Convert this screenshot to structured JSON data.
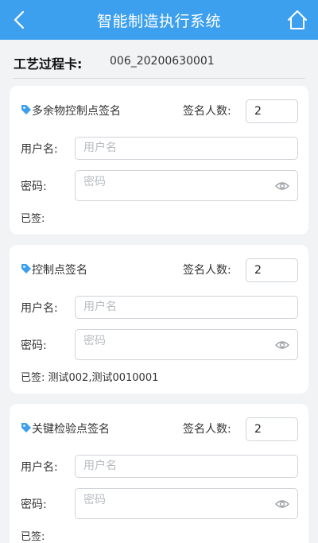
{
  "app": {
    "title": "智能制造执行系统",
    "accent_color": "#3da0ee"
  },
  "process_card": {
    "label": "工艺过程卡:",
    "value": "006_20200630001"
  },
  "sign_points": [
    {
      "title": "多余物控制点签名",
      "count_label": "签名人数:",
      "count_value": "2",
      "username_label": "用户名:",
      "username_placeholder": "用户名",
      "password_label": "密码:",
      "password_placeholder": "密码",
      "signed_text": "已签:"
    },
    {
      "title": "控制点签名",
      "count_label": "签名人数:",
      "count_value": "2",
      "username_label": "用户名:",
      "username_placeholder": "用户名",
      "password_label": "密码:",
      "password_placeholder": "密码",
      "signed_text": "已签: 测试002,测试0010001"
    },
    {
      "title": "关键检验点签名",
      "count_label": "签名人数:",
      "count_value": "2",
      "username_label": "用户名:",
      "username_placeholder": "用户名",
      "password_label": "密码:",
      "password_placeholder": "密码",
      "signed_text": "已签:"
    }
  ],
  "icons": {
    "back": "chevron-left-icon",
    "home": "home-icon",
    "tag": "tag-icon",
    "eye": "eye-icon"
  }
}
